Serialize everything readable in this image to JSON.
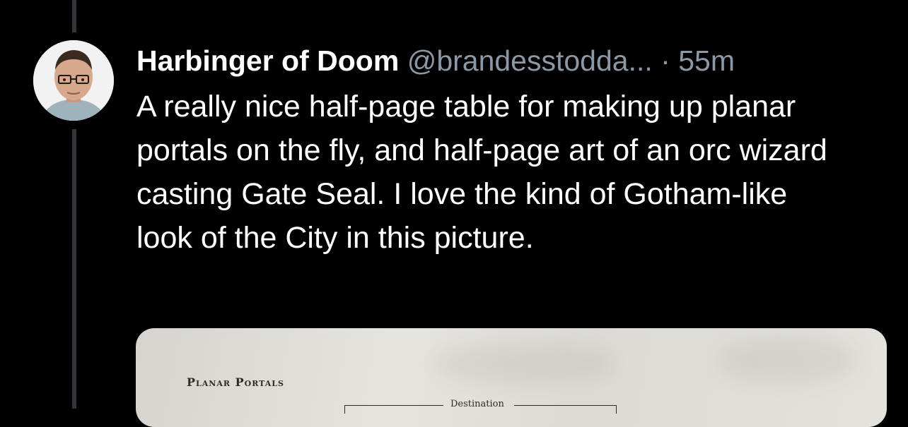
{
  "tweet": {
    "display_name": "Harbinger of Doom",
    "handle": "@brandesstodda...",
    "separator": "·",
    "time": "55m",
    "text": "A really nice half-page table for making up planar portals on the fly, and half-page art of an orc wizard casting Gate Seal. I love the kind of Gotham-like look of the City in this picture."
  },
  "media": {
    "table_title": "Planar Portals",
    "column_header": "Destination"
  },
  "colors": {
    "background": "#000000",
    "text_primary": "#ffffff",
    "text_secondary": "#8b98a5",
    "thread_line": "#333639"
  }
}
